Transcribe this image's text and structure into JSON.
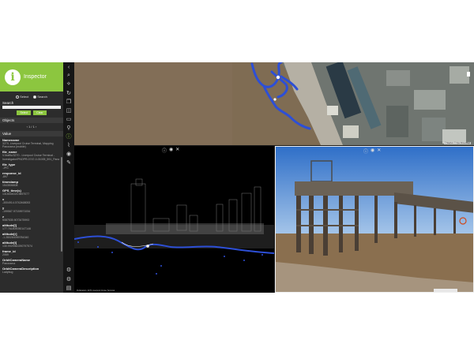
{
  "inspector": {
    "title": "Inspector",
    "logo_glyph": "i",
    "modes": [
      "Select",
      "Search"
    ],
    "search_label": "Search",
    "buttons": {
      "select": "Select",
      "clear": "Clear"
    },
    "objects_label": "Objects",
    "pager": "‹  1 / 1  ›",
    "values_label": "Value",
    "fields": [
      {
        "name": "Namename",
        "value": "3270, Liverpool Cruise Terminal, Mapping Panorama (mobile)"
      },
      {
        "name": "file_name",
        "value": "V:/traffic/3270 - Liverpool Cruise Terminal - Investigator/PNOPR-0747-0-01005_591_Pano"
      },
      {
        "name": "file_type",
        "value": ".JPG"
      },
      {
        "name": "response_id",
        "value": "-897"
      },
      {
        "name": "timestamp",
        "value": "1543506808"
      },
      {
        "name": "GPS_time(s)",
        "value": "1315004023.9897077"
      },
      {
        "name": "x",
        "value": "-3004914.0742468053"
      },
      {
        "name": "y",
        "value": "-199567.97159971934"
      },
      {
        "name": "z",
        "value": "5087535.9073475993"
      },
      {
        "name": "altitude[l]",
        "value": "177.761809050147146"
      },
      {
        "name": "altitude[r]",
        "value": "-1.280284059784340"
      },
      {
        "name": "altitude[t]",
        "value": "130.9929960290797574"
      },
      {
        "name": "frame_id",
        "value": "2059"
      },
      {
        "name": "OrbitCameraName",
        "value": "Panorama"
      },
      {
        "name": "OrbitCameraDescription",
        "value": "Ladybug"
      }
    ]
  },
  "toolbar": {
    "icons": [
      "chevron-left-icon",
      "search-icon",
      "measure-icon",
      "refresh-icon",
      "layers-icon",
      "cube-icon",
      "screen-icon",
      "map-pin-icon",
      "info-icon",
      "route-icon",
      "camera-icon",
      "comment-icon",
      "settings-icon",
      "gear-icon",
      "document-icon"
    ],
    "glyphs": [
      "‹",
      "⌕",
      "⟡",
      "↻",
      "❐",
      "◫",
      "▭",
      "⚲",
      "ⓘ",
      "⌇",
      "◉",
      "✎",
      "⚙",
      "⚙",
      "▤"
    ],
    "active_index": 8
  },
  "map": {
    "attribution": "© Mapbox © OpenStreetMap",
    "colors": {
      "water": "#7d6a52",
      "track": "#2d4fd6"
    }
  },
  "pointcloud": {
    "caption": "Publication: 3270 Liverpool Cruise Terminal",
    "controls": [
      "ⓘ",
      "◉",
      "✕"
    ]
  },
  "photo": {
    "controls": [
      "ⓘ",
      "◉",
      "✕"
    ]
  },
  "colors": {
    "accent": "#8cc63f",
    "panel": "#2c2c2c",
    "sky": "#3d7fd0"
  }
}
